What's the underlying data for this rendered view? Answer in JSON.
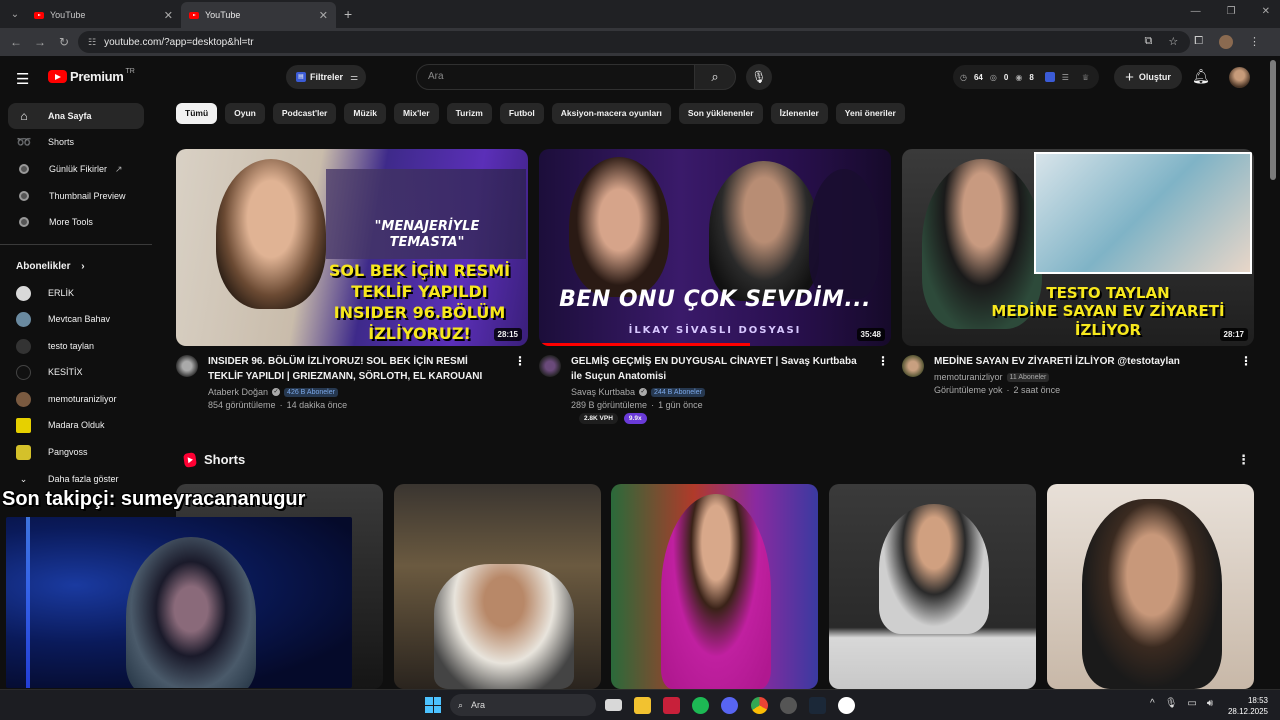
{
  "browser": {
    "tabs": [
      {
        "title": "YouTube",
        "active": false
      },
      {
        "title": "YouTube",
        "active": true
      }
    ],
    "url": "youtube.com/?app=desktop&hl=tr"
  },
  "header": {
    "logo_text": "Premium",
    "region": "TR",
    "filter_label": "Filtreler",
    "search_placeholder": "Ara",
    "stats": {
      "a": "64",
      "b": "0",
      "c": "8"
    },
    "create_label": "Oluştur"
  },
  "sidebar": {
    "items": [
      {
        "label": "Ana Sayfa",
        "icon": "home-icon"
      },
      {
        "label": "Shorts",
        "icon": "shorts-icon"
      },
      {
        "label": "Günlük Fikirler",
        "icon": "extension-icon"
      },
      {
        "label": "Thumbnail Preview",
        "icon": "extension-icon"
      },
      {
        "label": "More Tools",
        "icon": "extension-icon"
      }
    ],
    "subs_heading": "Abonelikler",
    "subscriptions": [
      {
        "name": "ERLİK",
        "color": "#d9d9d9"
      },
      {
        "name": "Mevtcan Bahav",
        "color": "#6a8aa0"
      },
      {
        "name": "testo taylan",
        "color": "#222"
      },
      {
        "name": "KESİTİX",
        "color": "#111"
      },
      {
        "name": "memoturanizliyor",
        "color": "#7a5a40"
      },
      {
        "name": "Madara Olduk",
        "color": "#e6d000"
      },
      {
        "name": "Pangvoss",
        "color": "#d4c12a"
      }
    ],
    "more_label": "Daha fazla göster"
  },
  "chips": [
    "Tümü",
    "Oyun",
    "Podcast'ler",
    "Müzik",
    "Mix'ler",
    "Turizm",
    "Futbol",
    "Aksiyon-macera oyunları",
    "Son yüklenenler",
    "İzlenenler",
    "Yeni öneriler"
  ],
  "videos": [
    {
      "title": "INSIDER 96. BÖLÜM İZLİYORUZ! SOL BEK İÇİN RESMİ TEKLİF YAPILDI | GRIEZMANN, SÖRLOTH, EL KAROUANI",
      "channel": "Ataberk Doğan",
      "subs": "426 B Aboneler",
      "views": "854 görüntüleme",
      "age": "14 dakika önce",
      "duration": "28:15",
      "thumb_text": [
        "\"MENAJERİYLE",
        "TEMASTA\"",
        "SOL BEK İÇİN RESMİ",
        "TEKLİF YAPILDI",
        "INSIDER 96.BÖLÜM",
        "İZLİYORUZ!"
      ]
    },
    {
      "title": "GELMİŞ GEÇMİŞ EN DUYGUSAL CİNAYET | Savaş Kurtbaba ile Suçun Anatomisi",
      "channel": "Savaş Kurtbaba",
      "subs": "244 B Aboneler",
      "views": "289 B görüntüleme",
      "age": "1 gün önce",
      "duration": "35:48",
      "thumb_text": [
        "BEN ONU ÇOK SEVDİM...",
        "İLKAY SİVASLI DOSYASI"
      ],
      "vph": "2.8K VPH",
      "ratio": "9.9x"
    },
    {
      "title": "MEDİNE SAYAN EV ZİYARETİ İZLİYOR @testotaylan",
      "channel": "memoturanizliyor",
      "subs": "11 Aboneler",
      "views": "Görüntüleme yok",
      "age": "2 saat önce",
      "duration": "28:17",
      "thumb_text": [
        "TESTO TAYLAN",
        "MEDİNE SAYAN EV ZİYARETİ",
        "İZLİYOR"
      ]
    }
  ],
  "shorts": {
    "heading": "Shorts"
  },
  "overlay": {
    "follower_text": "Son takipçi: sumeyracananugur"
  },
  "taskbar": {
    "search": "Ara",
    "time": "18:53",
    "date": "28.12.2025"
  }
}
